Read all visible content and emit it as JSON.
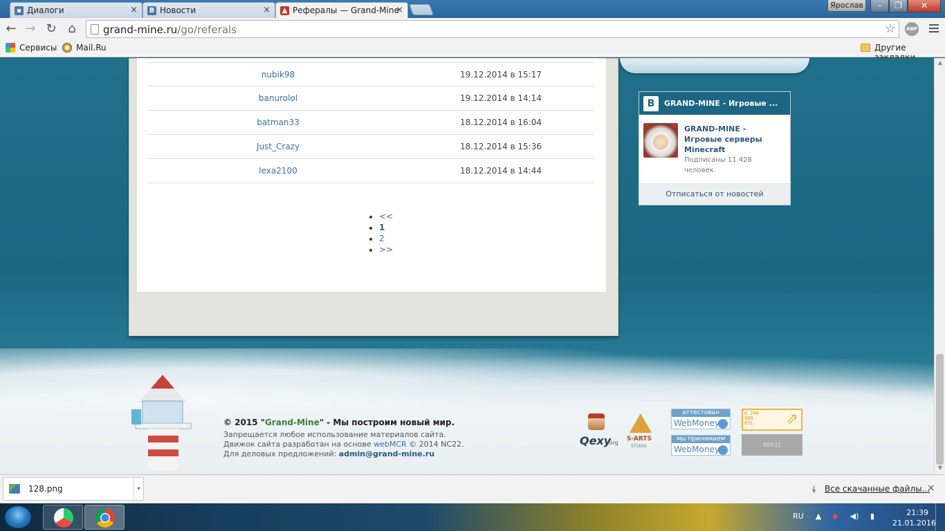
{
  "browser": {
    "tabs": [
      {
        "title": "Диалоги",
        "icon": "vk-message-icon"
      },
      {
        "title": "Новости",
        "icon": "vk-icon"
      },
      {
        "title": "Рефералы — Grand-Mine",
        "icon": "grandmine-favicon",
        "active": true
      }
    ],
    "user": "Ярослав",
    "url_host": "grand-mine.ru",
    "url_path": "/go/referals",
    "abp_label": "ABP",
    "bookmarks": [
      {
        "label": "Сервисы",
        "icon": "apps-grid-icon"
      },
      {
        "label": "Mail.Ru",
        "icon": "mailru-icon"
      }
    ],
    "other_bookmarks": "Другие закладки"
  },
  "referrals": [
    {
      "nick": "nubik98",
      "date": "19.12.2014 в 15:17"
    },
    {
      "nick": "banurolol",
      "date": "19.12.2014 в 14:14"
    },
    {
      "nick": "batman33",
      "date": "18.12.2014 в 16:04"
    },
    {
      "nick": "Just_Crazy",
      "date": "18.12.2014 в 15:36"
    },
    {
      "nick": "lexa2100",
      "date": "18.12.2014 в 14:44"
    }
  ],
  "pagination": {
    "prev": "<<",
    "pages": [
      "1",
      "2"
    ],
    "current": "1",
    "next": ">>"
  },
  "vk_widget": {
    "header": "GRAND-MINE - Игровые ...",
    "logo": "B",
    "group_name": "GRAND-MINE - Игровые серверы Minecraft",
    "subscribers": "Подписаны 11 428 человек",
    "unsubscribe": "Отписаться от новостей"
  },
  "footer": {
    "copyright_prefix": "© 2015 \"",
    "brand": "Grand-Mine",
    "copyright_suffix": "\" - Мы построим новый мир.",
    "line1": "Запрещается любое использование материалов сайта.",
    "line2_prefix": "Движок сайта разработан на основе ",
    "engine_link": "webMCR",
    "line2_suffix": " © 2014 NC22.",
    "line3_prefix": "Для деловых предложений: ",
    "email": "admin@grand-mine.ru"
  },
  "badges": {
    "qexy": "Qexy",
    "qexy_suffix": ".org",
    "sarts": "S·ARTS",
    "sarts_sub": "STUDIO",
    "wm1_top": "аттестован",
    "wm2_top": "мы принимаем",
    "wm_label": "WebMoney",
    "counter_digits": [
      "6 248",
      "888",
      "851"
    ],
    "counter2": "88X31"
  },
  "downloads": {
    "file": "128.png",
    "all": "Все скачанные файлы..."
  },
  "taskbar": {
    "lang": "RU",
    "time": "21:39",
    "date": "21.01.2016"
  }
}
